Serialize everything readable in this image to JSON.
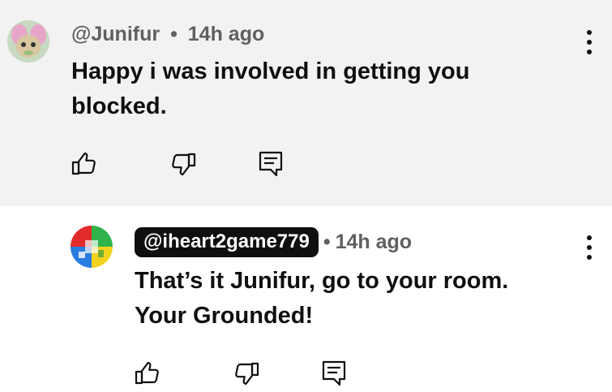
{
  "comments": [
    {
      "author": "@Junifur",
      "separator": "•",
      "time": "14h ago",
      "lines": [
        "Happy i was involved in getting you",
        "blocked."
      ]
    },
    {
      "author": "@iheart2game779",
      "separator": "•",
      "time": "14h ago",
      "lines": [
        "That’s it Junifur, go to your room.",
        "Your Grounded!"
      ]
    }
  ],
  "icons": {
    "like": "thumbs-up-icon",
    "dislike": "thumbs-down-icon",
    "reply": "reply-comment-icon",
    "menu": "more-vertical-icon"
  },
  "colors": {
    "first_comment_bg": "#f2f2f2",
    "author_pill_bg": "#0f0f0f",
    "meta_text": "#606060"
  }
}
